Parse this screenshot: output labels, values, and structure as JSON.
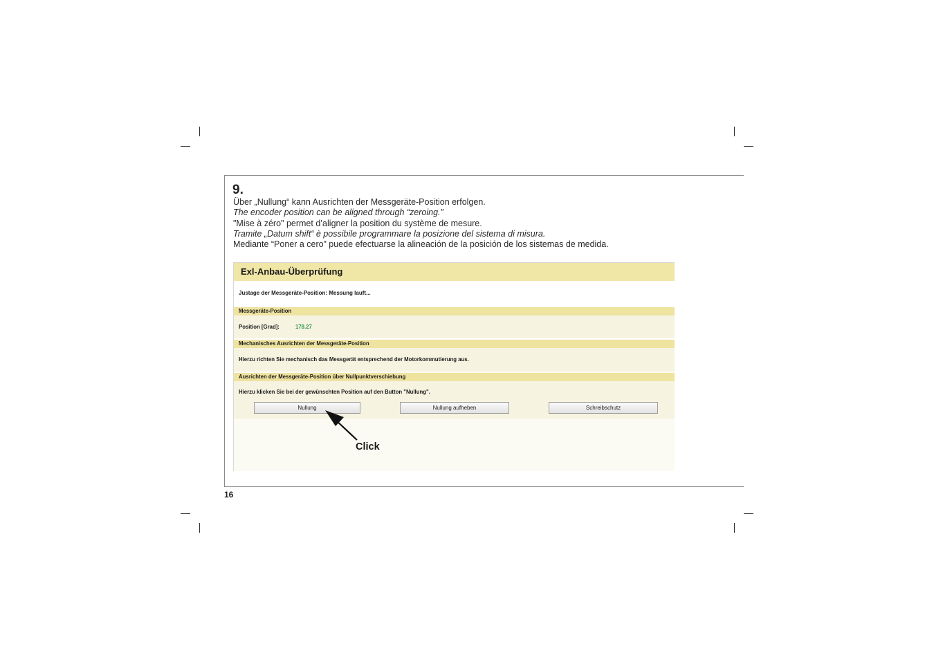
{
  "step": {
    "number": "9."
  },
  "description": {
    "de": "Über „Nullung“ kann Ausrichten der Messgeräte-Position erfolgen.",
    "en": "The encoder position can be aligned through “zeroing.”",
    "fr": "\"Mise à zéro\" permet d’aligner la position du système de mesure.",
    "it": "Tramite „Datum shift“ è possibile programmare la posizione del sistema di misura.",
    "es": "Mediante  “Poner a cero” puede efectuarse la alineación de la posición de los sistemas de medida."
  },
  "screenshot": {
    "title": "Exl-Anbau-Überprüfung",
    "status": "Justage der Messgeräte-Position: Messung lauft...",
    "sections": [
      {
        "title": "Messgeräte-Position",
        "label": "Position [Grad]:",
        "value": "178.27"
      },
      {
        "title": "Mechanisches Ausrichten der Messgeräte-Position",
        "text": "Hierzu richten Sie mechanisch das Messgerät entsprechend der Motorkommutierung aus."
      },
      {
        "title": "Ausrichten der Messgeräte-Position über Nullpunktverschiebung",
        "text": "Hierzu klicken Sie bei der gewünschten Position auf den Button \"Nullung\"."
      }
    ],
    "buttons": {
      "zero": "Nullung",
      "cancel_zero": "Nullung aufheben",
      "write_protect": "Schreibschutz"
    },
    "value_color": "#2e9a4a",
    "header_color": "#f0e6a6"
  },
  "annotation": {
    "label": "Click"
  },
  "page": {
    "number": "16"
  }
}
